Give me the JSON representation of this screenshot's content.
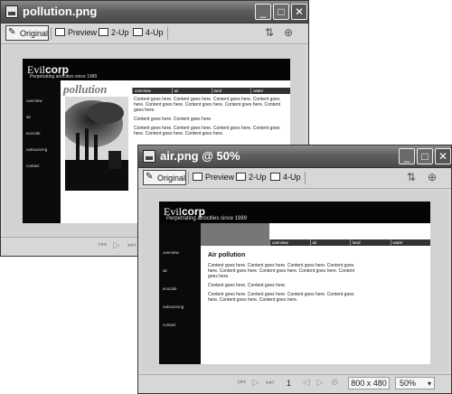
{
  "window1": {
    "title": "pollution.png",
    "tabs": [
      "Original",
      "Preview",
      "2-Up",
      "4-Up"
    ],
    "page": {
      "logo_evil": "Evil",
      "logo_corp": "corp",
      "tagline": "Perpetrating atrocities since 1989",
      "nav": [
        "overview",
        "air",
        "land",
        "water"
      ],
      "left_nav": [
        "overview",
        "air",
        "ecocide",
        "outsourcing",
        "contact"
      ],
      "section_title": "pollution",
      "paragraphs": [
        "Content goes here. Content goes here. Content goes here. Content goes here. Content goes here. Content goes here. Content goes here. Content goes here.",
        "Content goes here. Content goes here.",
        "Content goes here. Content goes here. Content goes here. Content goes here. Content goes here. Content goes here."
      ]
    }
  },
  "window2": {
    "title": "air.png @  50%",
    "tabs": [
      "Original",
      "Preview",
      "2-Up",
      "4-Up"
    ],
    "page": {
      "logo_evil": "Evil",
      "logo_corp": "corp",
      "tagline": "Perpetrating atrocities since 1989",
      "nav": [
        "overview",
        "air",
        "land",
        "water"
      ],
      "left_nav": [
        "overview",
        "air",
        "ecocide",
        "outsourcing",
        "contact"
      ],
      "heading": "Air pollution",
      "paragraphs": [
        "Content goes here. Content goes here. Content goes here. Content goes here. Content goes here. Content goes here. Content goes here. Content goes here.",
        "Content goes here. Content goes here.",
        "Content goes here. Content goes here. Content goes here. Content goes here. Content goes here. Content goes here."
      ]
    },
    "status": {
      "frame": "1",
      "size": "800 x 480",
      "zoom": "50%"
    }
  }
}
